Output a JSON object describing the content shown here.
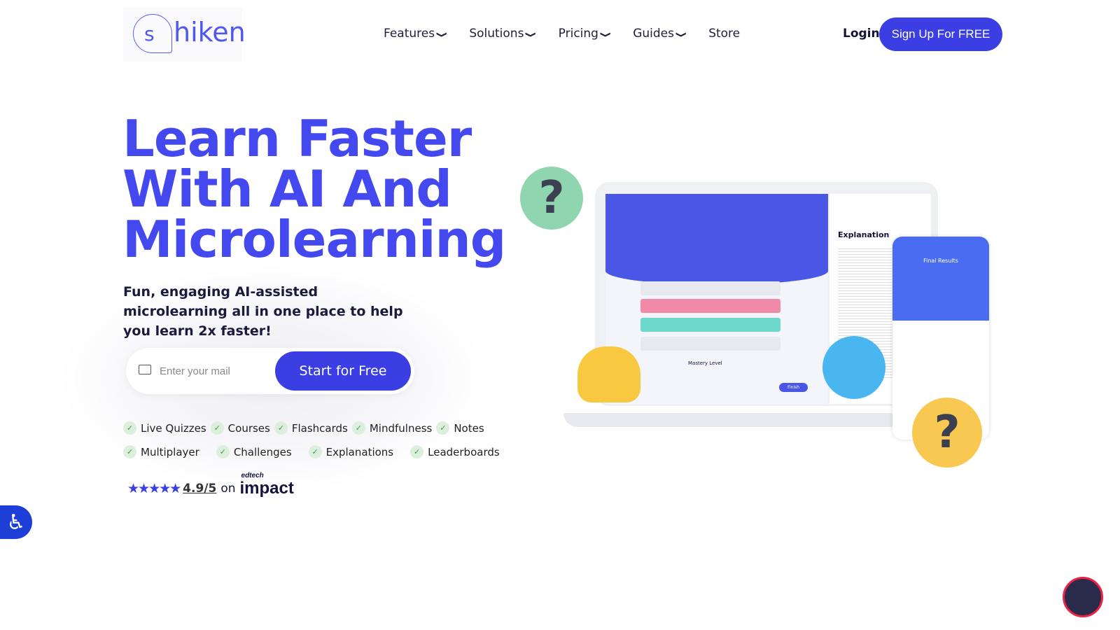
{
  "brand": {
    "logo_s": "s",
    "logo_name": "hiken"
  },
  "nav": {
    "items": [
      {
        "label": "Features",
        "dropdown": true
      },
      {
        "label": "Solutions",
        "dropdown": true
      },
      {
        "label": "Pricing",
        "dropdown": true
      },
      {
        "label": "Guides",
        "dropdown": true
      },
      {
        "label": "Store",
        "dropdown": false
      }
    ],
    "login": "Login",
    "signup": "Sign Up For FREE"
  },
  "hero": {
    "title_lines": [
      "Learn Faster",
      "With AI And",
      "Microlearning"
    ],
    "subtitle": "Fun, engaging AI-assisted microlearning all in one place to help you learn 2x faster!",
    "email_placeholder": "Enter your mail",
    "cta": "Start for Free",
    "features_row1": [
      "Live Quizzes",
      "Courses",
      "Flashcards",
      "Mindfulness",
      "Notes"
    ],
    "features_row2": [
      "Multiplayer",
      "Challenges",
      "Explanations",
      "Leaderboards"
    ],
    "rating": {
      "stars": "★★★★★",
      "score": "4.9/5",
      "on": "on",
      "source_small": "edtech",
      "source": "impact"
    }
  },
  "illustration": {
    "explanation_title": "Explanation",
    "final_results": "Final Results",
    "mastery": "Mastery Level",
    "finish": "Finish"
  },
  "colors": {
    "accent": "#3b3fe3",
    "heading": "#4349ee",
    "check_bg": "#dcefdc"
  }
}
